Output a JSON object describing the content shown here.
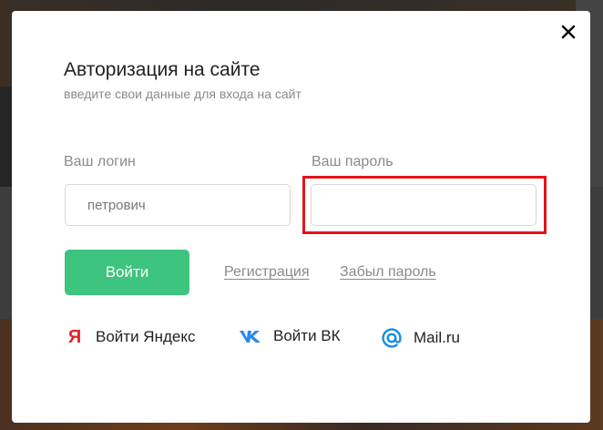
{
  "modal": {
    "title": "Авторизация на сайте",
    "subtitle": "введите свои данные для входа на сайт",
    "close_icon": "close-icon"
  },
  "form": {
    "login_label": "Ваш логин",
    "login_placeholder": "петрович",
    "password_label": "Ваш пароль",
    "password_value": "",
    "submit_label": "Войти",
    "register_link": "Регистрация",
    "forgot_link": "Забыл пароль"
  },
  "social": {
    "yandex": {
      "icon": "yandex-icon",
      "glyph": "Я",
      "label": "Войти Яндекс"
    },
    "vk": {
      "icon": "vk-icon",
      "label": "Войти ВК"
    },
    "mail": {
      "icon": "mail-at-icon",
      "label": "Mail.ru"
    }
  },
  "colors": {
    "accent_green": "#3dc47e",
    "highlight_red": "#e4141b",
    "yandex_red": "#e3252b",
    "vk_blue": "#2787f5",
    "mail_blue": "#168de2"
  }
}
